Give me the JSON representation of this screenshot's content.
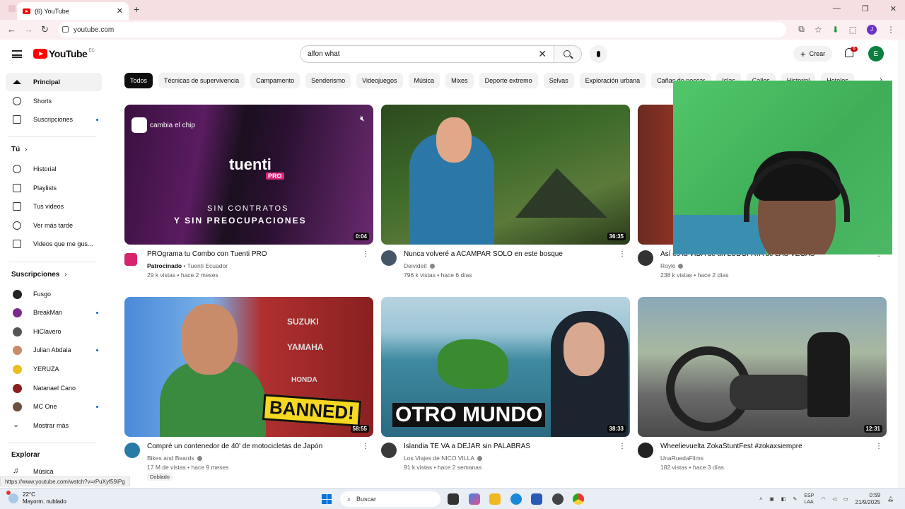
{
  "browser": {
    "tab_title": "(6) YouTube",
    "url": "youtube.com",
    "status_url": "https://www.youtube.com/watch?v=rPuXyf59iPg"
  },
  "header": {
    "logo_text": "YouTube",
    "country": "EC",
    "search_value": "alfon what",
    "create_label": "Crear",
    "notification_count": "6",
    "user_initial": "E",
    "browser_profile_initial": "J"
  },
  "sidebar": {
    "main": [
      {
        "label": "Principal",
        "icon": "home-icon"
      },
      {
        "label": "Shorts",
        "icon": "shorts-icon"
      },
      {
        "label": "Suscripciones",
        "icon": "subscriptions-icon"
      }
    ],
    "you_heading": "Tú",
    "you": [
      {
        "label": "Historial",
        "icon": "history-icon"
      },
      {
        "label": "Playlists",
        "icon": "playlists-icon"
      },
      {
        "label": "Tus videos",
        "icon": "your-videos-icon"
      },
      {
        "label": "Ver más tarde",
        "icon": "watch-later-icon"
      },
      {
        "label": "Videos que me gus...",
        "icon": "liked-icon"
      }
    ],
    "subs_heading": "Suscripciones",
    "subs": [
      {
        "label": "Fusgo",
        "color": "#222222"
      },
      {
        "label": "BreakMan",
        "color": "#7a2a8a"
      },
      {
        "label": "HiClavero",
        "color": "#555555"
      },
      {
        "label": "Julian Abdala",
        "color": "#c98a6a"
      },
      {
        "label": "YERUZA",
        "color": "#e8c020"
      },
      {
        "label": "Natanael Cano",
        "color": "#8a2020"
      },
      {
        "label": "MC One",
        "color": "#6a5040"
      }
    ],
    "show_more": "Mostrar más",
    "explore_heading": "Explorar",
    "explore": [
      {
        "label": "Música",
        "icon": "music-icon"
      }
    ]
  },
  "chips": [
    "Todos",
    "Técnicas de supervivencia",
    "Campamento",
    "Senderismo",
    "Videojuegos",
    "Música",
    "Mixes",
    "Deporte extremo",
    "Selvas",
    "Exploración urbana",
    "Cañas de pescar",
    "Islas",
    "Calles",
    "Historial",
    "Hoteles"
  ],
  "videos": [
    {
      "title": "PROgrama tu Combo con Tuenti PRO",
      "channel": "Tuenti Ecuador",
      "sponsored": "Patrocinado",
      "stats": "29 k vistas • hace 2 meses",
      "duration": "0:04",
      "avatar": "#d6246e"
    },
    {
      "title": "Nunca volveré a ACAMPAR SOLO en este bosque",
      "channel": "Deivideit",
      "stats": "796 k vistas • hace 6 días",
      "duration": "36:35",
      "avatar": "#445566"
    },
    {
      "title": "Así es la VIDA de un LUDÓPATA de LAS VEGAS",
      "channel": "Royki",
      "stats": "238 k vistas • hace 2 días",
      "duration": "",
      "avatar": "#333333"
    },
    {
      "title": "Compré un contenedor de 40' de motocicletas de Japón",
      "channel": "Bikes and Beards",
      "stats": "17 M de vistas • hace 9 meses",
      "duration": "58:55",
      "avatar": "#2a7aa8",
      "badge": "Doblado"
    },
    {
      "title": "Islandia TE VA a DEJAR sin PALABRAS",
      "channel": "Los Viajes de NICO VILLA",
      "stats": "91 k vistas • hace 2 semanas",
      "duration": "38:33",
      "avatar": "#3a3a3a"
    },
    {
      "title": "Wheelievuelta ZokaStuntFest #zokaxsiempre",
      "channel": "UnaRuedaFilms",
      "stats": "182 vistas • hace 3 días",
      "duration": "12:31",
      "avatar": "#222222"
    }
  ],
  "thumb_text": {
    "tuenti_badge": "cambia el chip",
    "tuenti_logo": "tuenti",
    "tuenti_pro": "PRO",
    "tuenti_line1": "SIN CONTRATOS",
    "tuenti_line2": "Y SIN PREOCUPACIONES",
    "banned": "BANNED!",
    "suzuki": "SUZUKI",
    "yamaha": "YAMAHA",
    "honda": "HONDA",
    "otro_mundo": "OTRO MUNDO"
  },
  "taskbar": {
    "temp": "22°C",
    "weather": "Mayorm. nublado",
    "search": "Buscar",
    "lang1": "ESP",
    "lang2": "LAA",
    "time": "0:59",
    "date": "21/9/2025"
  }
}
